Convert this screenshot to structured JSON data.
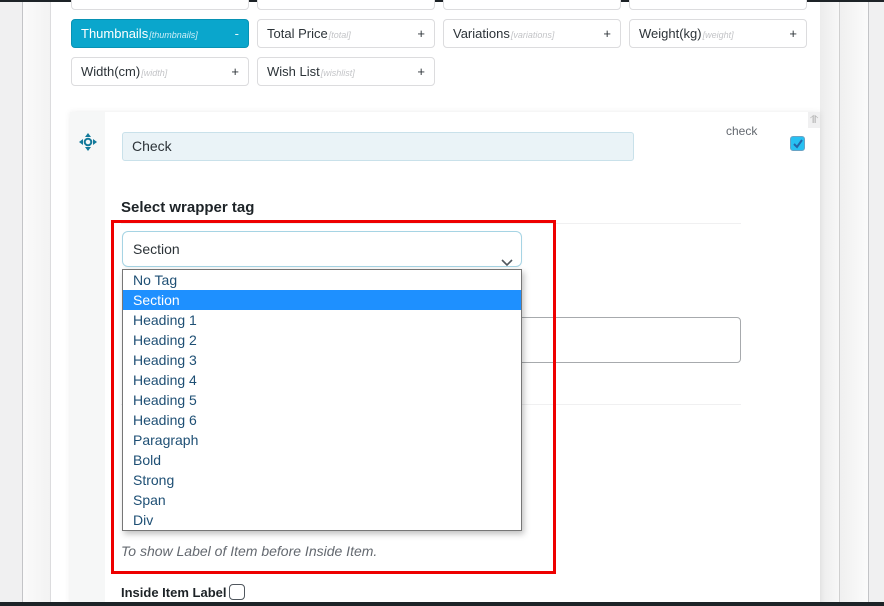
{
  "field_chips": {
    "row1": [
      {
        "label": "Thumbnails",
        "tag": "[thumbnails]",
        "action": "-",
        "active": true
      },
      {
        "label": "Total Price",
        "tag": "[total]",
        "action": "+",
        "active": false
      },
      {
        "label": "Variations",
        "tag": "[variations]",
        "action": "+",
        "active": false
      },
      {
        "label": "Weight(kg)",
        "tag": "[weight]",
        "action": "+",
        "active": false
      }
    ],
    "row2": [
      {
        "label": "Width(cm)",
        "tag": "[width]",
        "action": "+",
        "active": false
      },
      {
        "label": "Wish List",
        "tag": "[wishlist]",
        "action": "+",
        "active": false
      }
    ]
  },
  "item_card": {
    "name_value": "Check",
    "check_label": "check",
    "check_checked": true,
    "wrapper_section_title": "Select wrapper tag",
    "wrapper_select": {
      "selected": "Section",
      "options": [
        "No Tag",
        "Section",
        "Heading 1",
        "Heading 2",
        "Heading 3",
        "Heading 4",
        "Heading 5",
        "Heading 6",
        "Paragraph",
        "Bold",
        "Strong",
        "Span",
        "Div"
      ]
    },
    "hint_text": "To show Label of Item before Inside Item.",
    "inside_item_label": "Inside Item Label",
    "inside_item_checked": false
  },
  "colors": {
    "accent": "#0aa6cc",
    "option_selected_bg": "#1e90ff",
    "highlight_border": "#ee0000"
  }
}
